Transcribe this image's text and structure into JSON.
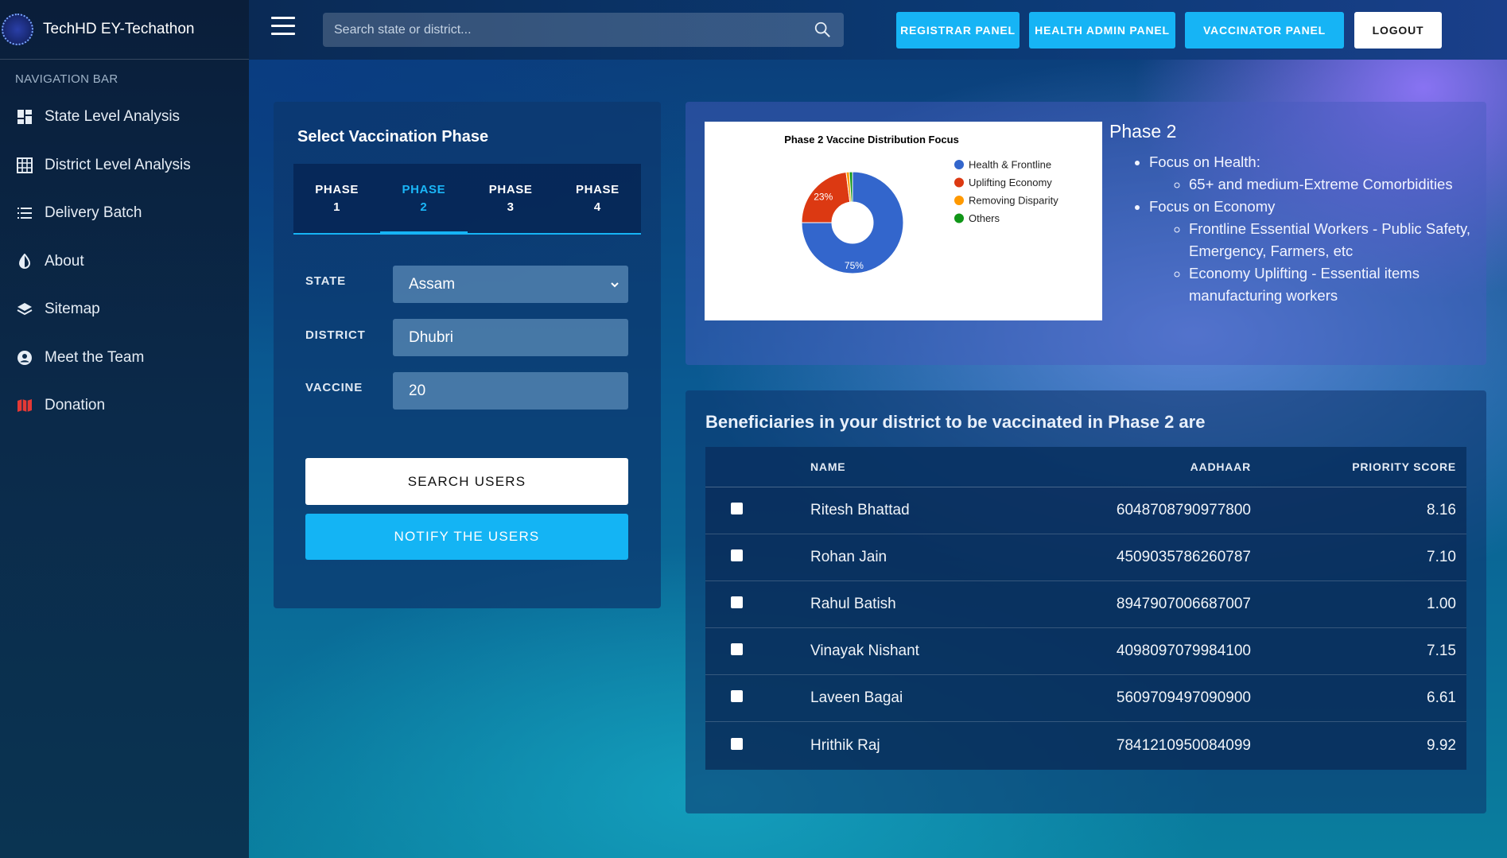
{
  "sidebar": {
    "brand": "TechHD EY-Techathon",
    "heading": "NAVIGATION BAR",
    "items": [
      {
        "label": "State Level Analysis",
        "icon": "dashboard-icon"
      },
      {
        "label": "District Level Analysis",
        "icon": "grid-icon"
      },
      {
        "label": "Delivery Batch",
        "icon": "list-icon"
      },
      {
        "label": "About",
        "icon": "contrast-icon"
      },
      {
        "label": "Sitemap",
        "icon": "layers-icon"
      },
      {
        "label": "Meet the Team",
        "icon": "user-circle-icon"
      },
      {
        "label": "Donation",
        "icon": "map-icon"
      }
    ]
  },
  "topbar": {
    "search_placeholder": "Search state or district...",
    "registrar": "REGISTRAR PANEL",
    "health_admin": "HEALTH ADMIN PANEL",
    "vaccinator": "VACCINATOR PANEL",
    "logout": "LOGOUT"
  },
  "phase_card": {
    "title": "Select Vaccination Phase",
    "tabs": [
      {
        "l1": "PHASE",
        "l2": "1"
      },
      {
        "l1": "PHASE",
        "l2": "2"
      },
      {
        "l1": "PHASE",
        "l2": "3"
      },
      {
        "l1": "PHASE",
        "l2": "4"
      }
    ],
    "active_tab": 1,
    "state_label": "STATE",
    "state_value": "Assam",
    "district_label": "DISTRICT",
    "district_value": "Dhubri",
    "vaccine_label": "VACCINE",
    "vaccine_value": "20",
    "search_btn": "SEARCH USERS",
    "notify_btn": "NOTIFY THE USERS"
  },
  "info": {
    "title": "Phase 2",
    "health_heading": "Focus on Health:",
    "health_items": [
      "65+ and medium-Extreme Comorbidities"
    ],
    "economy_heading": "Focus on Economy",
    "economy_items": [
      "Frontline Essential Workers - Public Safety, Emergency, Farmers, etc",
      "Economy Uplifting - Essential items manufacturing workers"
    ]
  },
  "chart_data": {
    "type": "pie",
    "title": "Phase 2 Vaccine Distribution Focus",
    "donut": true,
    "categories": [
      "Health & Frontline",
      "Uplifting Economy",
      "Removing Disparity",
      "Others"
    ],
    "values": [
      75,
      23,
      1,
      1
    ],
    "data_labels": [
      "75%",
      "23%",
      "",
      ""
    ],
    "colors": [
      "#3366cc",
      "#dc3912",
      "#ff9900",
      "#109618"
    ],
    "legend": "right"
  },
  "beneficiaries": {
    "title": "Beneficiaries in your district to be vaccinated in Phase 2 are",
    "columns": {
      "name": "NAME",
      "aadhaar": "AADHAAR",
      "score": "PRIORITY SCORE"
    },
    "rows": [
      {
        "name": "Ritesh Bhattad",
        "aadhaar": "6048708790977800",
        "score": "8.16"
      },
      {
        "name": "Rohan Jain",
        "aadhaar": "4509035786260787",
        "score": "7.10"
      },
      {
        "name": "Rahul Batish",
        "aadhaar": "8947907006687007",
        "score": "1.00"
      },
      {
        "name": "Vinayak Nishant",
        "aadhaar": "4098097079984100",
        "score": "7.15"
      },
      {
        "name": "Laveen Bagai",
        "aadhaar": "5609709497090900",
        "score": "6.61"
      },
      {
        "name": "Hrithik Raj",
        "aadhaar": "7841210950084099",
        "score": "9.92"
      }
    ]
  }
}
